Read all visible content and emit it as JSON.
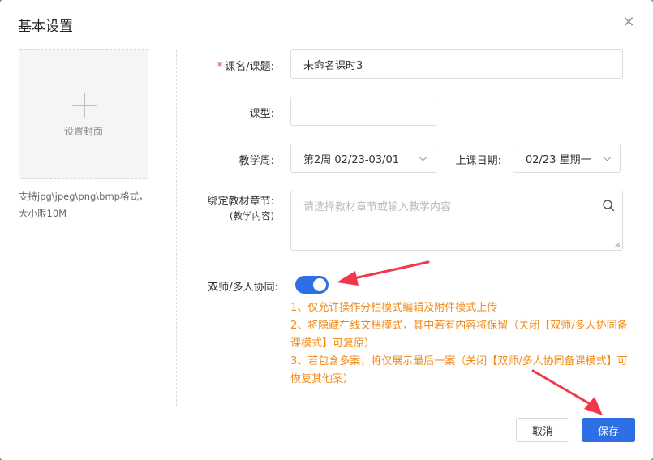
{
  "dialog": {
    "title": "基本设置",
    "close_icon": "close-icon"
  },
  "cover": {
    "label": "设置封面",
    "hint": "支持jpg\\jpeg\\png\\bmp格式，大小限10M"
  },
  "form": {
    "course_name": {
      "required_mark": "*",
      "label": "课名/课题:",
      "value": "未命名课时3"
    },
    "course_type": {
      "label": "课型:",
      "value": ""
    },
    "teaching_week": {
      "label": "教学周:",
      "value": "第2周 02/23-03/01"
    },
    "class_date": {
      "label": "上课日期:",
      "value": "02/23 星期一"
    },
    "chapter": {
      "label": "绑定教材章节:",
      "sublabel": "(教学内容)",
      "placeholder": "请选择教材章节或输入教学内容"
    },
    "collab": {
      "label": "双师/多人协同:",
      "enabled": true
    }
  },
  "notes": [
    "1、仅允许操作分栏模式编辑及附件模式上传",
    "2、将隐藏在线文档模式，其中若有内容将保留（关闭【双师/多人协同备课模式】可复原）",
    "3、若包含多案，将仅展示最后一案（关闭【双师/多人协同备课模式】可恢复其他案）"
  ],
  "buttons": {
    "cancel": "取消",
    "save": "保存"
  },
  "colors": {
    "primary": "#2f6fe6",
    "warning_text": "#f08c1c",
    "annotation_arrow": "#f0384a"
  }
}
